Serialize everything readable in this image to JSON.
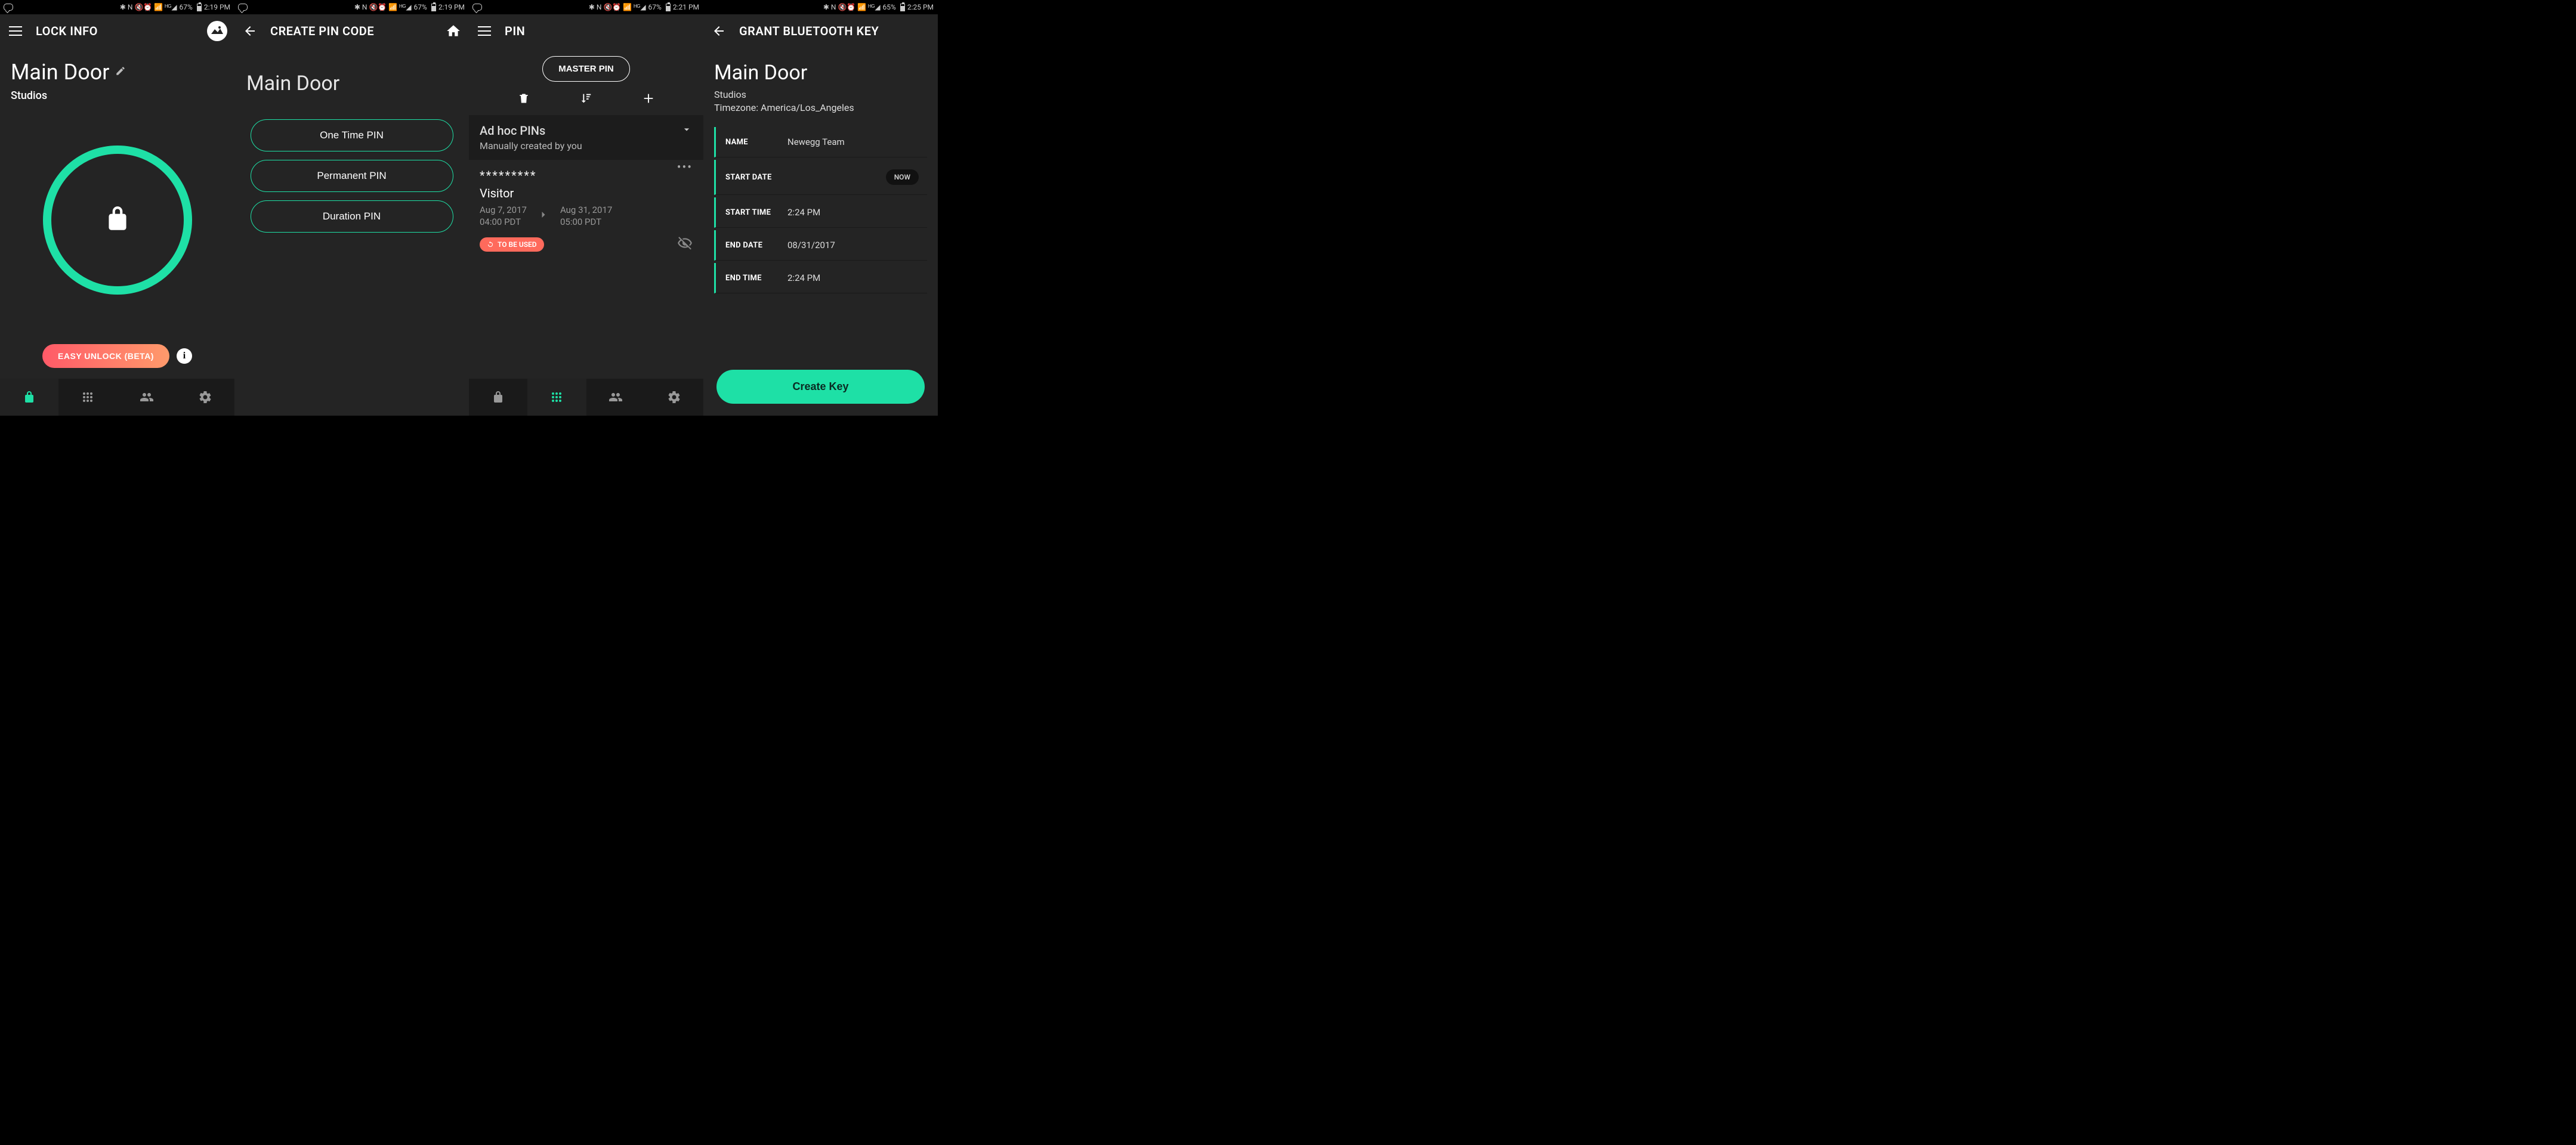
{
  "screens": [
    {
      "status": {
        "battery_pct": "67%",
        "time": "2:19 PM",
        "battery_fill": 67
      },
      "appbar": {
        "title": "LOCK INFO",
        "has_menu": true,
        "has_logo": true
      },
      "door_name": "Main Door",
      "org": "Studios",
      "easy_unlock_label": "EASY UNLOCK (BETA)",
      "bottom_nav_active": 0
    },
    {
      "status": {
        "battery_pct": "67%",
        "time": "2:19 PM",
        "battery_fill": 67
      },
      "appbar": {
        "title": "CREATE PIN CODE",
        "has_back": true,
        "has_home": true
      },
      "door_name": "Main Door",
      "pin_options": [
        "One Time PIN",
        "Permanent PIN",
        "Duration PIN"
      ]
    },
    {
      "status": {
        "battery_pct": "67%",
        "time": "2:21 PM",
        "battery_fill": 67
      },
      "appbar": {
        "title": "PIN",
        "has_menu": true
      },
      "master_pin_label": "MASTER PIN",
      "section": {
        "title": "Ad hoc PINs",
        "subtitle": "Manually created by you"
      },
      "pin_item": {
        "mask": "*********",
        "name": "Visitor",
        "from_date": "Aug 7, 2017",
        "from_time": "04:00 PDT",
        "to_date": "Aug 31, 2017",
        "to_time": "05:00 PDT",
        "chip": "TO BE USED"
      },
      "bottom_nav_active": 1
    },
    {
      "status": {
        "battery_pct": "65%",
        "time": "2:25 PM",
        "battery_fill": 65
      },
      "appbar": {
        "title": "GRANT BLUETOOTH KEY",
        "has_back": true
      },
      "door_name": "Main Door",
      "org": "Studios",
      "timezone_label": "Timezone: America/Los_Angeles",
      "fields": {
        "name_label": "NAME",
        "name_value": "Newegg Team",
        "start_date_label": "START DATE",
        "now_label": "NOW",
        "start_time_label": "START TIME",
        "start_time_value": "2:24 PM",
        "end_date_label": "END DATE",
        "end_date_value": "08/31/2017",
        "end_time_label": "END TIME",
        "end_time_value": "2:24 PM"
      },
      "create_key_label": "Create Key"
    }
  ],
  "status_icons_text": "✱ ℕ 🔇 ⏰ 📶 ᴴᴳ ◢"
}
